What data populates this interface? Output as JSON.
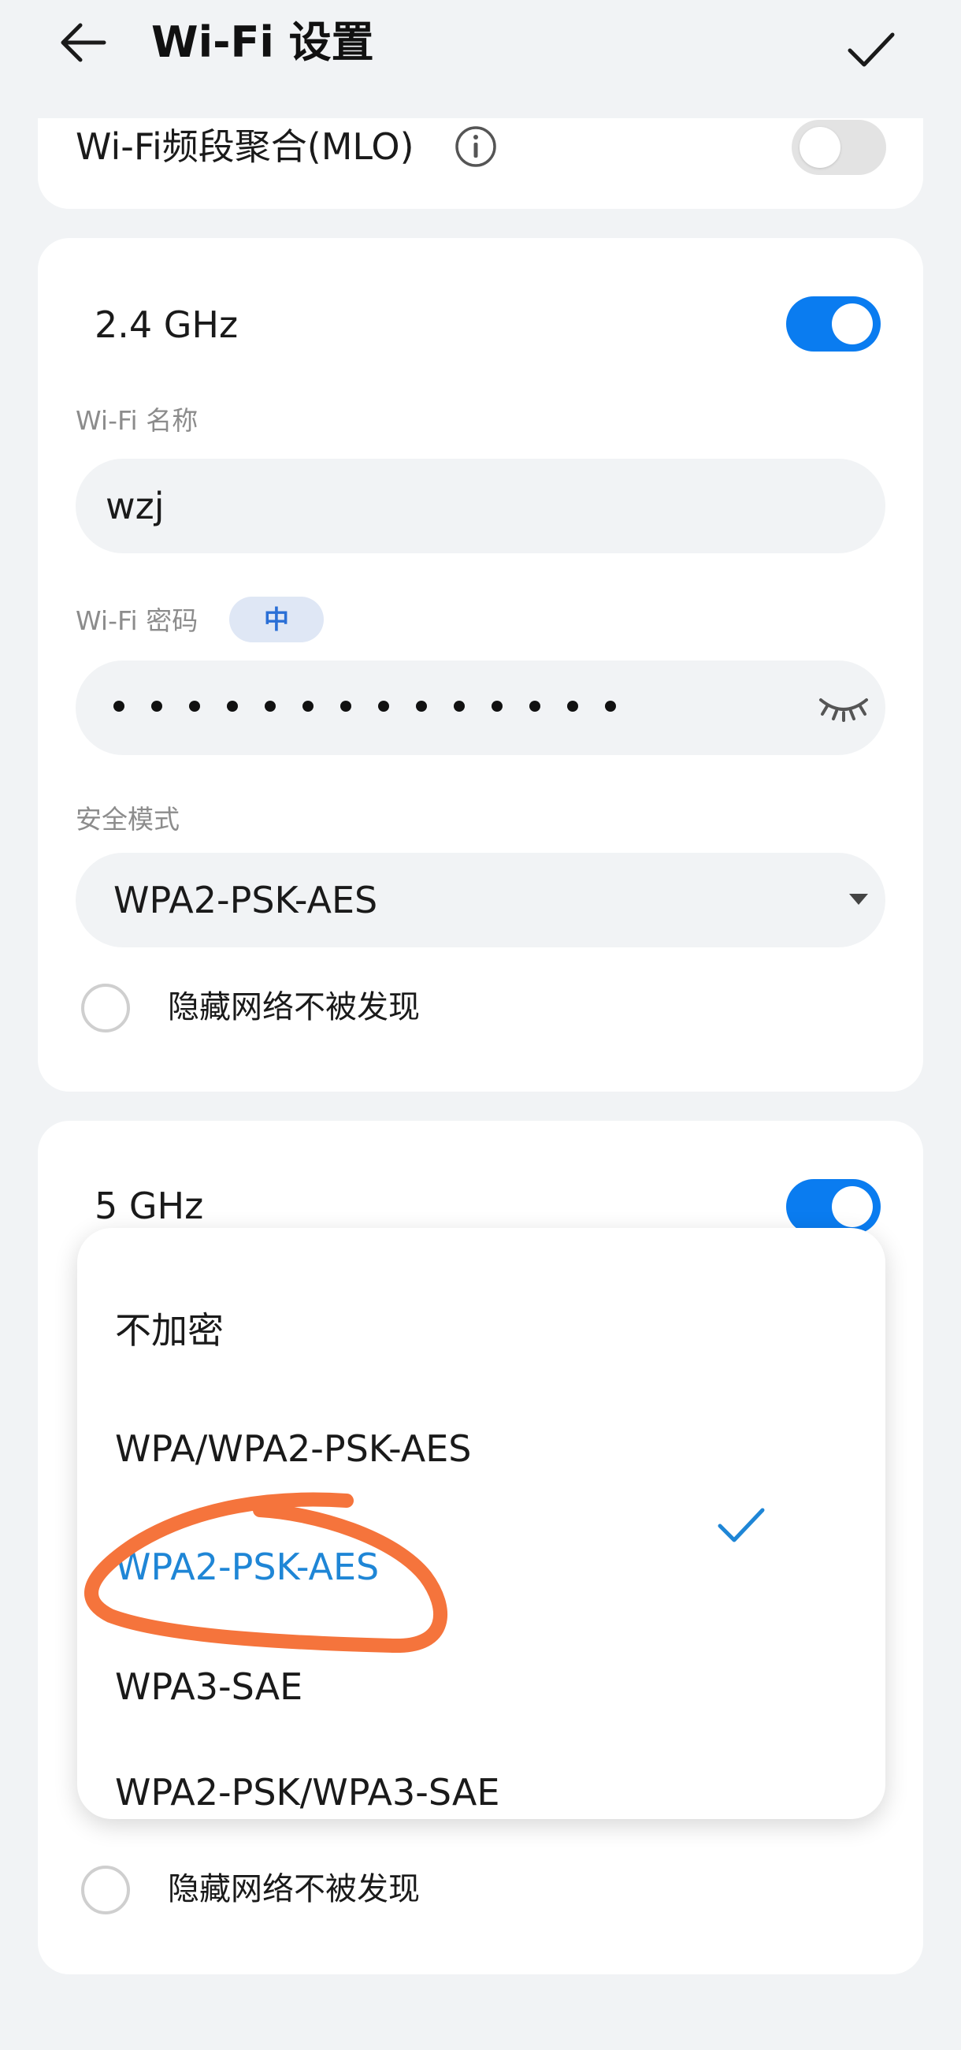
{
  "header": {
    "title": "Wi-Fi 设置"
  },
  "mlo": {
    "label": "Wi-Fi频段聚合(MLO)",
    "enabled": false
  },
  "band_24": {
    "label": "2.4 GHz",
    "enabled": true,
    "name_label": "Wi-Fi 名称",
    "name_value": "wzj",
    "password_label": "Wi-Fi 密码",
    "password_strength": "中",
    "password_masked_length": 14,
    "security_label": "安全模式",
    "security_value": "WPA2-PSK-AES",
    "hide_label": "隐藏网络不被发现",
    "hide_checked": false
  },
  "band_5": {
    "label": "5 GHz",
    "enabled": true,
    "hide_label": "隐藏网络不被发现",
    "hide_checked": false
  },
  "dropdown": {
    "options": [
      "不加密",
      "WPA/WPA2-PSK-AES",
      "WPA2-PSK-AES",
      "WPA3-SAE",
      "WPA2-PSK/WPA3-SAE"
    ],
    "selected": "WPA2-PSK-AES"
  },
  "colors": {
    "accent": "#0a7cf0",
    "selected_text": "#1f86d6",
    "annotation": "#f5743c"
  }
}
